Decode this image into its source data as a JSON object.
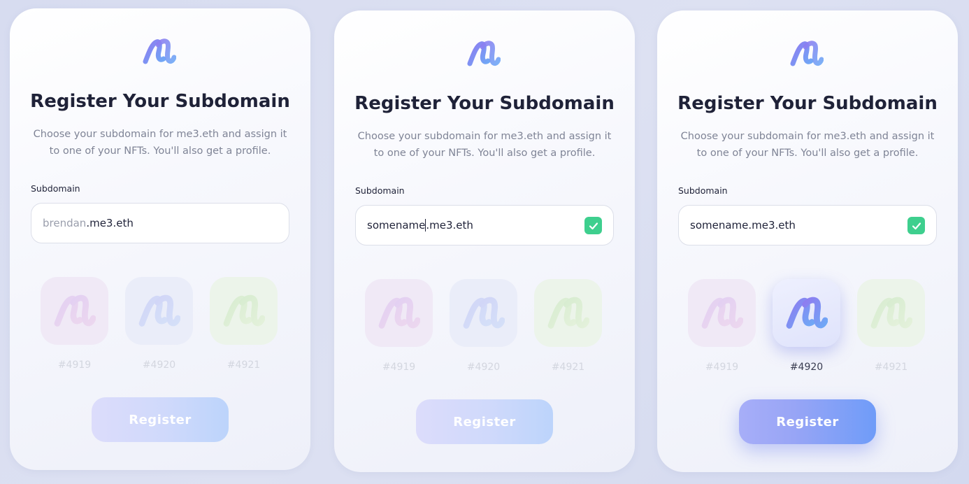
{
  "colors": {
    "title": "#1f2238",
    "subtitle": "#7f8496",
    "check_green": "#3ecf8e",
    "logo_gradient_start": "#8e7cf0",
    "logo_gradient_end": "#6fa8f6"
  },
  "icons": {
    "logo": "me3-logo-icon",
    "check": "checkmark-icon"
  },
  "cards": [
    {
      "title": "Register Your Subdomain",
      "subtitle": "Choose your subdomain for me3.eth and assign it to one of your NFTs. You'll also get a profile.",
      "field_label": "Subdomain",
      "input": {
        "typed": "",
        "placeholder": "brendan",
        "suffix": ".me3.eth",
        "valid": false
      },
      "nfts": [
        {
          "label": "#4919",
          "selected": false
        },
        {
          "label": "#4920",
          "selected": false
        },
        {
          "label": "#4921",
          "selected": false
        }
      ],
      "register_label": "Register",
      "register_enabled": false
    },
    {
      "title": "Register Your Subdomain",
      "subtitle": "Choose your subdomain for me3.eth and assign it to one of your NFTs. You'll also get a profile.",
      "field_label": "Subdomain",
      "input": {
        "typed": "somename",
        "placeholder": "",
        "suffix": ".me3.eth",
        "valid": true
      },
      "nfts": [
        {
          "label": "#4919",
          "selected": false
        },
        {
          "label": "#4920",
          "selected": false
        },
        {
          "label": "#4921",
          "selected": false
        }
      ],
      "register_label": "Register",
      "register_enabled": false
    },
    {
      "title": "Register Your Subdomain",
      "subtitle": "Choose your subdomain for me3.eth and assign it to one of your NFTs. You'll also get a profile.",
      "field_label": "Subdomain",
      "input": {
        "typed": "somename",
        "placeholder": "",
        "suffix": ".me3.eth",
        "valid": true
      },
      "nfts": [
        {
          "label": "#4919",
          "selected": false
        },
        {
          "label": "#4920",
          "selected": true
        },
        {
          "label": "#4921",
          "selected": false
        }
      ],
      "register_label": "Register",
      "register_enabled": true
    }
  ]
}
